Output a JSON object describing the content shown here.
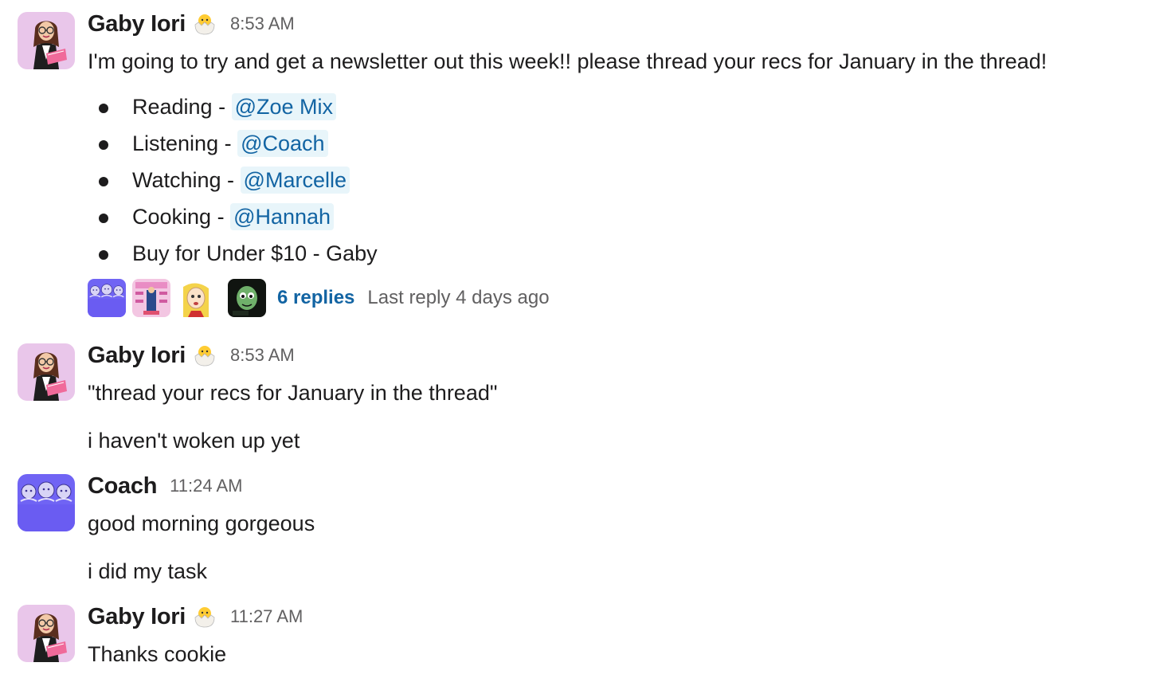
{
  "messages": [
    {
      "sender": "Gaby Iori",
      "status_emoji": "hatching-chick-icon",
      "time": "8:53 AM",
      "text": "I'm going to try and get a newsletter out this week!! please thread your recs for January in the thread!",
      "bullets": [
        {
          "label": "Reading - ",
          "mention": "@Zoe Mix"
        },
        {
          "label": "Listening - ",
          "mention": "@Coach"
        },
        {
          "label": "Watching - ",
          "mention": "@Marcelle"
        },
        {
          "label": "Cooking - ",
          "mention": "@Hannah"
        },
        {
          "label": "Buy for Under $10 - Gaby",
          "mention": ""
        }
      ],
      "thread": {
        "replies": "6 replies",
        "last_reply": "Last reply 4 days ago"
      }
    },
    {
      "sender": "Gaby Iori",
      "status_emoji": "hatching-chick-icon",
      "time": "8:53 AM",
      "lines": [
        "\"thread your recs for January in the thread\"",
        "i haven't woken up yet"
      ]
    },
    {
      "sender": "Coach",
      "time": "11:24 AM",
      "lines": [
        "good morning gorgeous",
        "i did my task"
      ]
    },
    {
      "sender": "Gaby Iori",
      "status_emoji": "hatching-chick-icon",
      "time": "11:27 AM",
      "lines": [
        "Thanks cookie"
      ]
    }
  ],
  "colors": {
    "mention_bg": "#e8f5fa",
    "mention_text": "#1264a3",
    "link": "#1264a3",
    "muted": "#616061",
    "coach_avatar": "#7064f4"
  }
}
